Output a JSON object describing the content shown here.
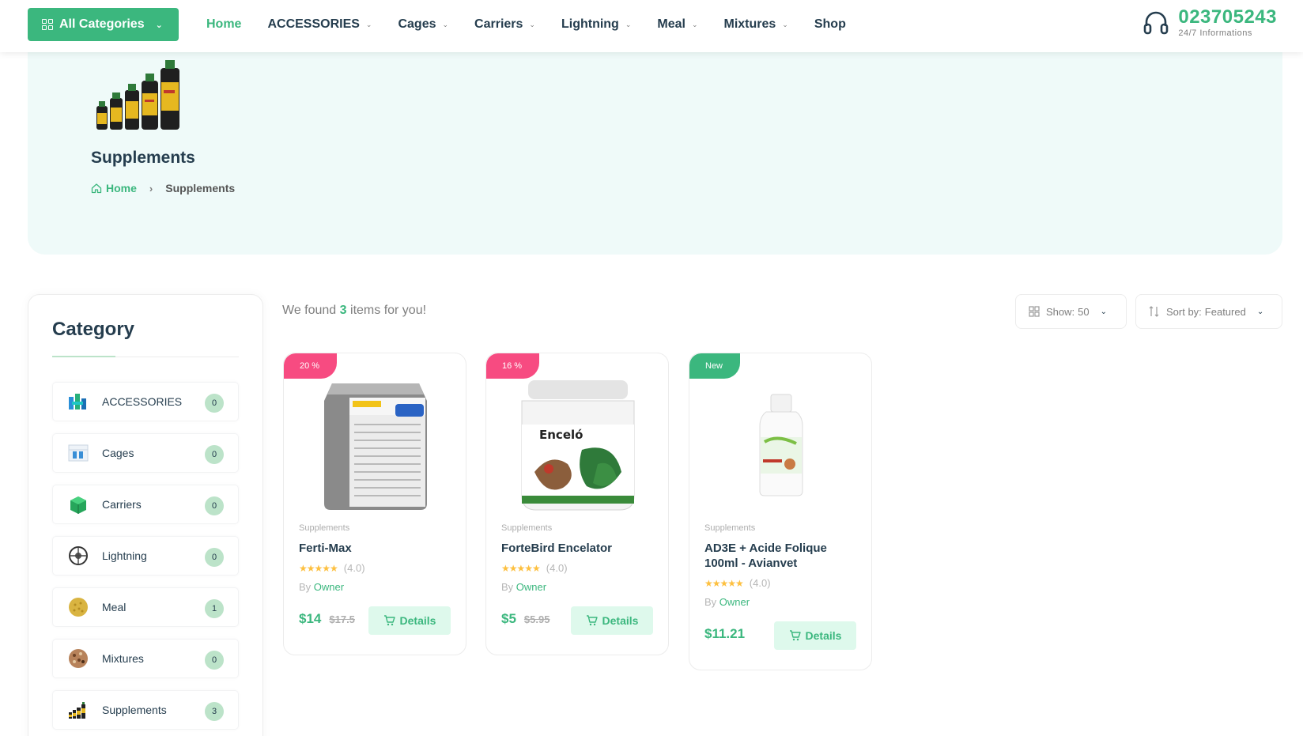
{
  "header": {
    "all_categories_label": "All Categories",
    "nav": [
      {
        "label": "Home",
        "active": true,
        "dropdown": false
      },
      {
        "label": "ACCESSORIES",
        "active": false,
        "dropdown": true
      },
      {
        "label": "Cages",
        "active": false,
        "dropdown": true
      },
      {
        "label": "Carriers",
        "active": false,
        "dropdown": true
      },
      {
        "label": "Lightning",
        "active": false,
        "dropdown": true
      },
      {
        "label": "Meal",
        "active": false,
        "dropdown": true
      },
      {
        "label": "Mixtures",
        "active": false,
        "dropdown": true
      },
      {
        "label": "Shop",
        "active": false,
        "dropdown": false
      }
    ],
    "phone_number": "023705243",
    "phone_sub": "24/7 Informations"
  },
  "hero": {
    "title": "Supplements",
    "breadcrumb_home": "Home",
    "breadcrumb_separator": "›",
    "breadcrumb_current": "Supplements"
  },
  "sidebar": {
    "title": "Category",
    "items": [
      {
        "label": "ACCESSORIES",
        "count": "0",
        "icon": "accessories-icon"
      },
      {
        "label": "Cages",
        "count": "0",
        "icon": "cages-icon"
      },
      {
        "label": "Carriers",
        "count": "0",
        "icon": "carriers-icon"
      },
      {
        "label": "Lightning",
        "count": "0",
        "icon": "lightning-icon"
      },
      {
        "label": "Meal",
        "count": "1",
        "icon": "meal-icon"
      },
      {
        "label": "Mixtures",
        "count": "0",
        "icon": "mixtures-icon"
      },
      {
        "label": "Supplements",
        "count": "3",
        "icon": "supplements-icon"
      }
    ]
  },
  "toolbar": {
    "found_prefix": "We found",
    "found_count": "3",
    "found_suffix": "items for you!",
    "show_label": "Show:",
    "show_value": "50",
    "sort_label": "Sort by:",
    "sort_value": "Featured"
  },
  "products": [
    {
      "badge": "20 %",
      "badge_type": "hot",
      "category": "Supplements",
      "name": "Ferti-Max",
      "rating": "(4.0)",
      "by_label": "By",
      "by": "Owner",
      "price": "$14",
      "old_price": "$17.5",
      "details_label": "Details"
    },
    {
      "badge": "16 %",
      "badge_type": "hot",
      "category": "Supplements",
      "name": "ForteBird Encelator",
      "rating": "(4.0)",
      "by_label": "By",
      "by": "Owner",
      "price": "$5",
      "old_price": "$5.95",
      "details_label": "Details"
    },
    {
      "badge": "New",
      "badge_type": "new",
      "category": "Supplements",
      "name": "AD3E + Acide Folique 100ml - Avianvet",
      "rating": "(4.0)",
      "by_label": "By",
      "by": "Owner",
      "price": "$11.21",
      "old_price": "",
      "details_label": "Details"
    }
  ],
  "colors": {
    "brand": "#3bb77e",
    "hot_badge": "#f74b81",
    "hero_bg": "#effaf9",
    "count_bg": "#bce3c9",
    "heading": "#253d4e"
  }
}
